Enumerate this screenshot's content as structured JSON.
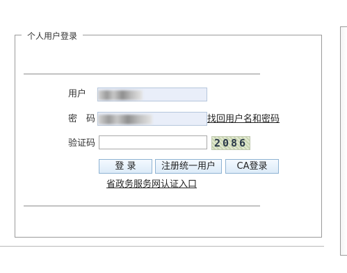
{
  "panel": {
    "legend": "个人用户登录"
  },
  "form": {
    "username_label": "用户",
    "password_label": "密　码",
    "captcha_label": "验证码",
    "captcha_text": "2086",
    "recover_link": "找回用户名和密码"
  },
  "buttons": {
    "login": "登 录",
    "register": "注册统一用户",
    "ca_login": "CA登录"
  },
  "portal_link": "省政务服务网认证入口"
}
